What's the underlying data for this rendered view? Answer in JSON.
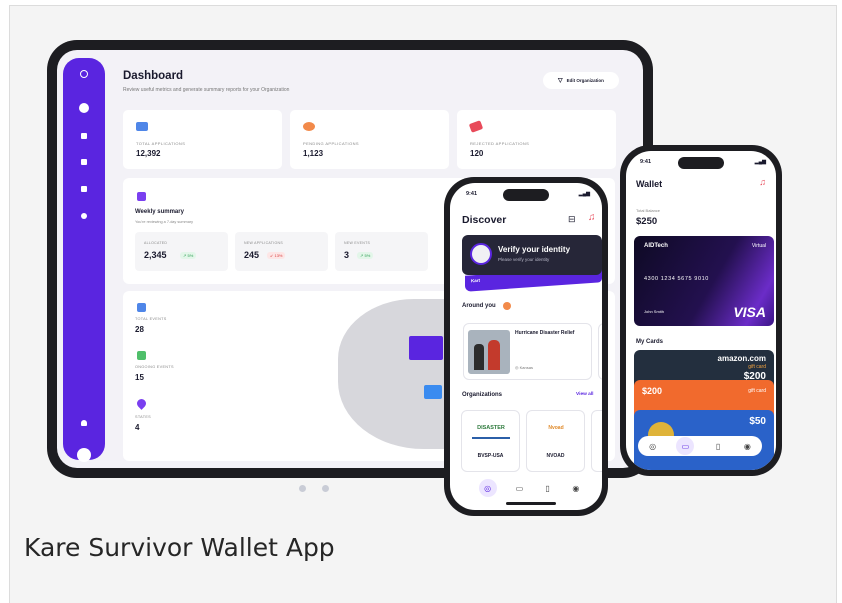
{
  "caption": "Kare Survivor Wallet App",
  "dashboard": {
    "title": "Dashboard",
    "subtitle": "Review useful metrics and generate summary reports for your Organization",
    "org_button": "Edit Organization",
    "stats": [
      {
        "label": "TOTAL APPLICATIONS",
        "value": "12,392",
        "color": "#4f86e8"
      },
      {
        "label": "PENDING APPLICATIONS",
        "value": "1,123",
        "color": "#f28a4a"
      },
      {
        "label": "REJECTED APPLICATIONS",
        "value": "120",
        "color": "#e84a5a"
      }
    ],
    "weekly": {
      "title": "Weekly summary",
      "subtitle": "You're reviewing a 7-day summary",
      "items": [
        {
          "label": "ALLOCATED",
          "value": "2,345",
          "trend": "↗ 5%",
          "dir": "up"
        },
        {
          "label": "NEW APPLICATIONS",
          "value": "245",
          "trend": "↙ 13%",
          "dir": "down"
        },
        {
          "label": "NEW EVENTS",
          "value": "3",
          "trend": "↗ 5%",
          "dir": "up"
        }
      ]
    },
    "events": [
      {
        "label": "TOTAL EVENTS",
        "value": "28",
        "color": "#4f86e8"
      },
      {
        "label": "ONGOING EVENTS",
        "value": "15",
        "color": "#4fbf6a"
      },
      {
        "label": "STATES",
        "value": "4",
        "color": "#7a3ff0"
      }
    ]
  },
  "discover": {
    "time": "9:41",
    "title": "Discover",
    "verify_title": "Verify your identity",
    "verify_sub": "Please verify your identity",
    "verify_band": "Kart",
    "around_you": "Around you",
    "event_name": "Hurricane Disaster Relief",
    "event_loc": "Kansas",
    "organizations": "Organizations",
    "view_all": "View all",
    "orgs": [
      {
        "logo": "DISASTER",
        "name": "BVSP-USA"
      },
      {
        "logo": "Nvoad",
        "name": "NVOAD"
      }
    ]
  },
  "wallet": {
    "time": "9:41",
    "title": "Wallet",
    "balance_label": "Total Balance",
    "balance": "$250",
    "card_brand": "AIDTech",
    "card_tag": "Virtual",
    "card_number": "4300 1234 5675 9010",
    "card_holder": "John Smith",
    "card_logo": "VISA",
    "my_cards": "My Cards",
    "gifts": [
      {
        "brand": "amazon.com",
        "value": "$200",
        "sub": "gift card"
      },
      {
        "brand": "",
        "value": "$200",
        "sub": "gift card"
      },
      {
        "brand": "",
        "value": "$50",
        "sub": ""
      }
    ]
  },
  "colors": {
    "accent": "#5a25e0",
    "frame": "#1d1d21"
  }
}
